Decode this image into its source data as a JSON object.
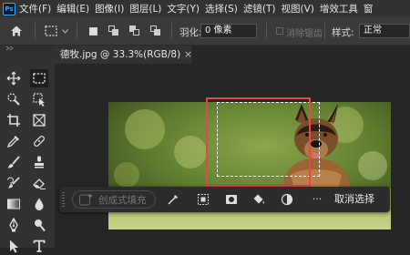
{
  "menubar": {
    "logo": "Ps",
    "items": [
      "文件(F)",
      "编辑(E)",
      "图像(I)",
      "图层(L)",
      "文字(Y)",
      "选择(S)",
      "滤镜(T)",
      "视图(V)",
      "增效工具",
      "窗"
    ]
  },
  "options": {
    "feather_label": "羽化:",
    "feather_value": "0 像素",
    "antialias_label": "消除锯齿",
    "style_label": "样式:",
    "style_value": "正常"
  },
  "document": {
    "tab_title": "德牧.jpg @ 33.3%(RGB/8)",
    "close_glyph": "×"
  },
  "taskbar": {
    "generative_fill": "创成式填充",
    "more": "···",
    "deselect": "取消选择"
  },
  "colors": {
    "highlight": "#e64747",
    "app_bg": "#262626",
    "panel_bg": "#323232"
  }
}
